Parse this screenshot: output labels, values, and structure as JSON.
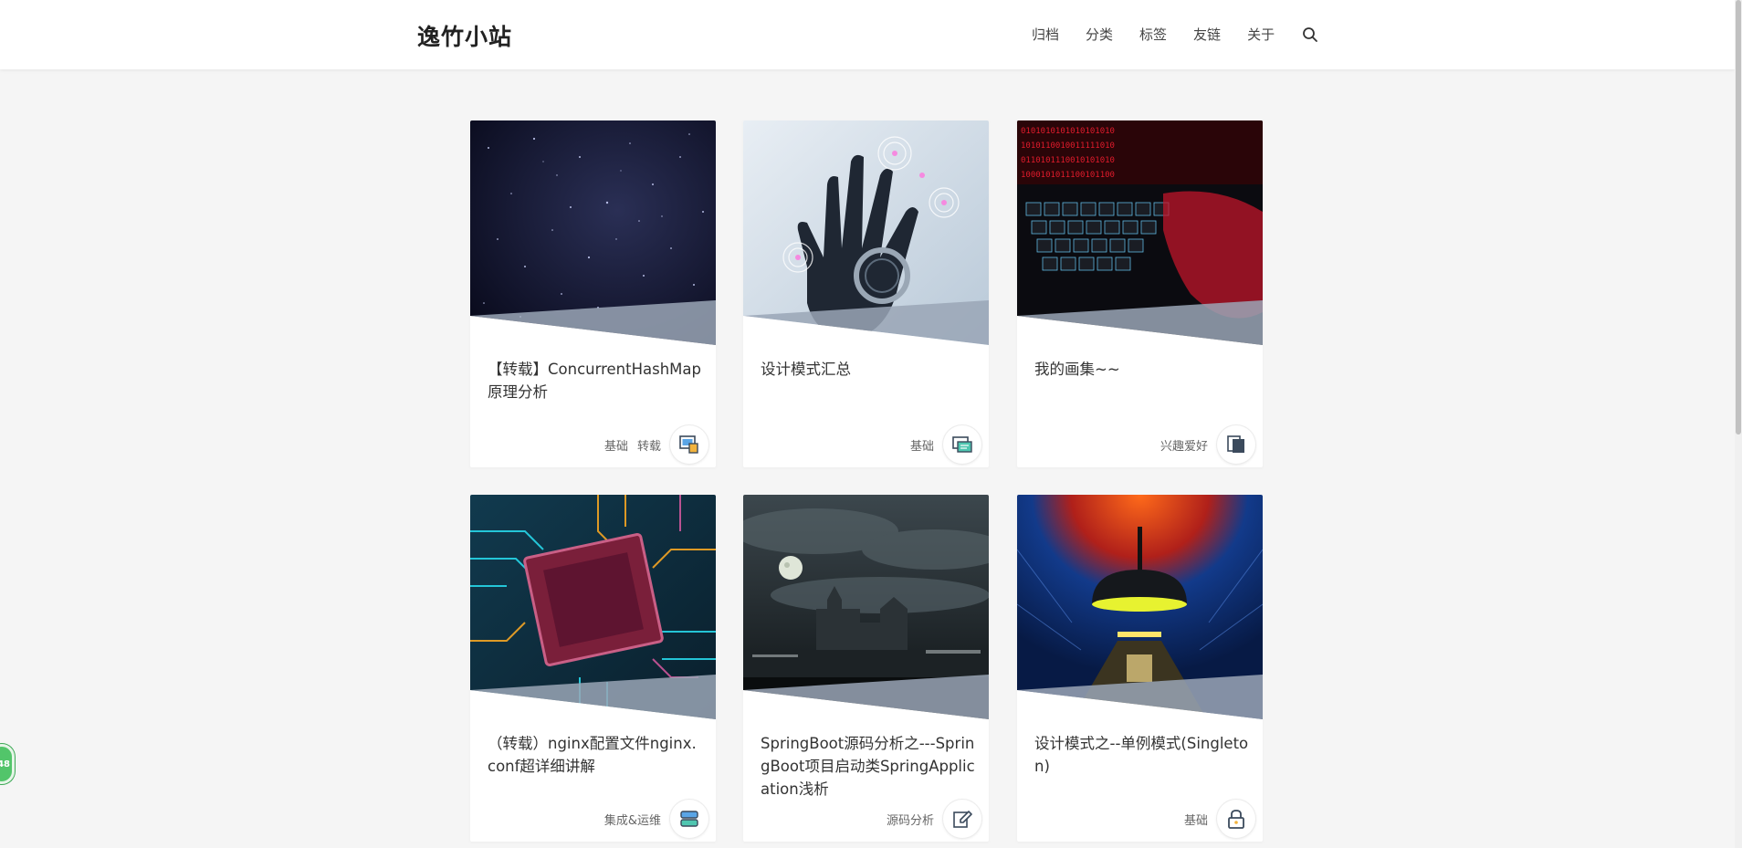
{
  "site": {
    "title": "逸竹小站"
  },
  "nav": {
    "items": [
      "归档",
      "分类",
      "标签",
      "友链",
      "关于"
    ]
  },
  "posts": [
    {
      "title": "【转载】ConcurrentHashMap原理分析",
      "tags": [
        "基础",
        "转载"
      ],
      "category_icon": "photo-gallery-icon"
    },
    {
      "title": "设计模式汇总",
      "tags": [
        "基础"
      ],
      "category_icon": "monitor-icon"
    },
    {
      "title": "我的画集~~",
      "tags": [
        "兴趣爱好"
      ],
      "category_icon": "copy-pages-icon"
    },
    {
      "title": "（转载）nginx配置文件nginx.conf超详细讲解",
      "tags": [
        "集成&运维"
      ],
      "category_icon": "server-stack-icon"
    },
    {
      "title": "SpringBoot源码分析之---SpringBoot项目启动类SpringApplication浅析",
      "tags": [
        "源码分析"
      ],
      "category_icon": "edit-pencil-icon"
    },
    {
      "title": "设计模式之--单例模式(Singleton)",
      "tags": [
        "基础"
      ],
      "category_icon": "padlock-icon"
    }
  ],
  "floating_badge": {
    "text": "48"
  },
  "colors": {
    "accent_green": "#52c56a",
    "page_bg": "#f5f5f5"
  }
}
